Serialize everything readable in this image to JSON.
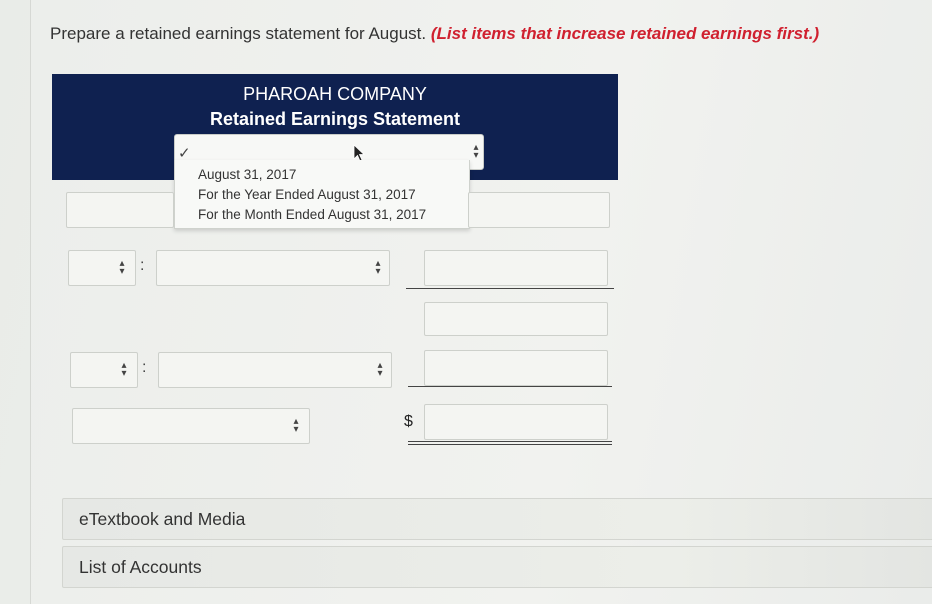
{
  "instructions": {
    "text": "Prepare a retained earnings statement for August.",
    "note": "(List items that increase retained earnings first.)"
  },
  "header": {
    "company": "PHAROAH COMPANY",
    "statement": "Retained Earnings Statement"
  },
  "date_select": {
    "selected": "",
    "options": [
      "August 31, 2017",
      "For the Year Ended August 31, 2017",
      "For the Month Ended August 31, 2017"
    ]
  },
  "rows": {
    "dollar_sign": "$"
  },
  "links": {
    "etextbook": "eTextbook and Media",
    "accounts": "List of Accounts"
  },
  "colors": {
    "header_bg": "#0f2150",
    "note_red": "#d0202f"
  }
}
